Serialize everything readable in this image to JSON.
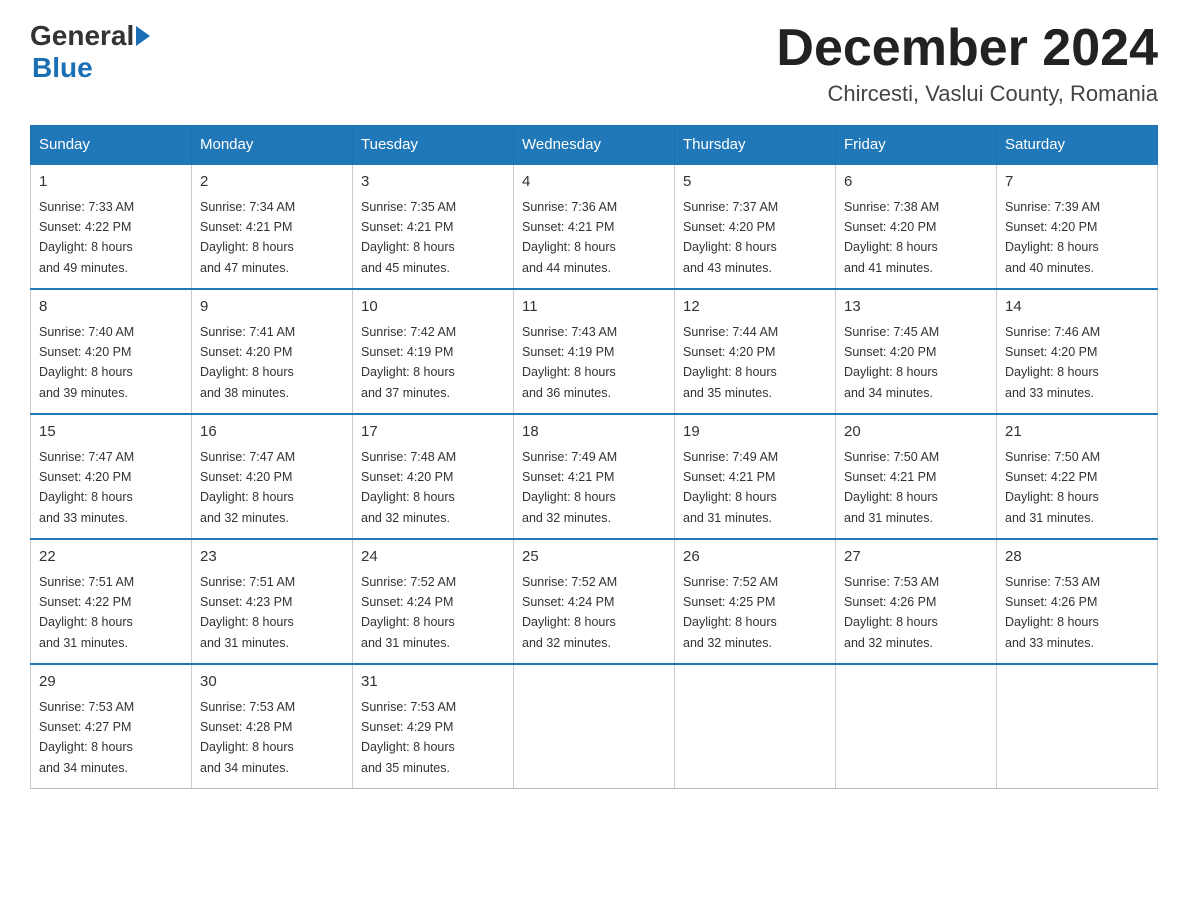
{
  "logo": {
    "general": "General",
    "blue": "Blue"
  },
  "header": {
    "month_year": "December 2024",
    "location": "Chircesti, Vaslui County, Romania"
  },
  "days_of_week": [
    "Sunday",
    "Monday",
    "Tuesday",
    "Wednesday",
    "Thursday",
    "Friday",
    "Saturday"
  ],
  "weeks": [
    [
      {
        "day": "1",
        "sunrise": "7:33 AM",
        "sunset": "4:22 PM",
        "daylight": "8 hours and 49 minutes."
      },
      {
        "day": "2",
        "sunrise": "7:34 AM",
        "sunset": "4:21 PM",
        "daylight": "8 hours and 47 minutes."
      },
      {
        "day": "3",
        "sunrise": "7:35 AM",
        "sunset": "4:21 PM",
        "daylight": "8 hours and 45 minutes."
      },
      {
        "day": "4",
        "sunrise": "7:36 AM",
        "sunset": "4:21 PM",
        "daylight": "8 hours and 44 minutes."
      },
      {
        "day": "5",
        "sunrise": "7:37 AM",
        "sunset": "4:20 PM",
        "daylight": "8 hours and 43 minutes."
      },
      {
        "day": "6",
        "sunrise": "7:38 AM",
        "sunset": "4:20 PM",
        "daylight": "8 hours and 41 minutes."
      },
      {
        "day": "7",
        "sunrise": "7:39 AM",
        "sunset": "4:20 PM",
        "daylight": "8 hours and 40 minutes."
      }
    ],
    [
      {
        "day": "8",
        "sunrise": "7:40 AM",
        "sunset": "4:20 PM",
        "daylight": "8 hours and 39 minutes."
      },
      {
        "day": "9",
        "sunrise": "7:41 AM",
        "sunset": "4:20 PM",
        "daylight": "8 hours and 38 minutes."
      },
      {
        "day": "10",
        "sunrise": "7:42 AM",
        "sunset": "4:19 PM",
        "daylight": "8 hours and 37 minutes."
      },
      {
        "day": "11",
        "sunrise": "7:43 AM",
        "sunset": "4:19 PM",
        "daylight": "8 hours and 36 minutes."
      },
      {
        "day": "12",
        "sunrise": "7:44 AM",
        "sunset": "4:20 PM",
        "daylight": "8 hours and 35 minutes."
      },
      {
        "day": "13",
        "sunrise": "7:45 AM",
        "sunset": "4:20 PM",
        "daylight": "8 hours and 34 minutes."
      },
      {
        "day": "14",
        "sunrise": "7:46 AM",
        "sunset": "4:20 PM",
        "daylight": "8 hours and 33 minutes."
      }
    ],
    [
      {
        "day": "15",
        "sunrise": "7:47 AM",
        "sunset": "4:20 PM",
        "daylight": "8 hours and 33 minutes."
      },
      {
        "day": "16",
        "sunrise": "7:47 AM",
        "sunset": "4:20 PM",
        "daylight": "8 hours and 32 minutes."
      },
      {
        "day": "17",
        "sunrise": "7:48 AM",
        "sunset": "4:20 PM",
        "daylight": "8 hours and 32 minutes."
      },
      {
        "day": "18",
        "sunrise": "7:49 AM",
        "sunset": "4:21 PM",
        "daylight": "8 hours and 32 minutes."
      },
      {
        "day": "19",
        "sunrise": "7:49 AM",
        "sunset": "4:21 PM",
        "daylight": "8 hours and 31 minutes."
      },
      {
        "day": "20",
        "sunrise": "7:50 AM",
        "sunset": "4:21 PM",
        "daylight": "8 hours and 31 minutes."
      },
      {
        "day": "21",
        "sunrise": "7:50 AM",
        "sunset": "4:22 PM",
        "daylight": "8 hours and 31 minutes."
      }
    ],
    [
      {
        "day": "22",
        "sunrise": "7:51 AM",
        "sunset": "4:22 PM",
        "daylight": "8 hours and 31 minutes."
      },
      {
        "day": "23",
        "sunrise": "7:51 AM",
        "sunset": "4:23 PM",
        "daylight": "8 hours and 31 minutes."
      },
      {
        "day": "24",
        "sunrise": "7:52 AM",
        "sunset": "4:24 PM",
        "daylight": "8 hours and 31 minutes."
      },
      {
        "day": "25",
        "sunrise": "7:52 AM",
        "sunset": "4:24 PM",
        "daylight": "8 hours and 32 minutes."
      },
      {
        "day": "26",
        "sunrise": "7:52 AM",
        "sunset": "4:25 PM",
        "daylight": "8 hours and 32 minutes."
      },
      {
        "day": "27",
        "sunrise": "7:53 AM",
        "sunset": "4:26 PM",
        "daylight": "8 hours and 32 minutes."
      },
      {
        "day": "28",
        "sunrise": "7:53 AM",
        "sunset": "4:26 PM",
        "daylight": "8 hours and 33 minutes."
      }
    ],
    [
      {
        "day": "29",
        "sunrise": "7:53 AM",
        "sunset": "4:27 PM",
        "daylight": "8 hours and 34 minutes."
      },
      {
        "day": "30",
        "sunrise": "7:53 AM",
        "sunset": "4:28 PM",
        "daylight": "8 hours and 34 minutes."
      },
      {
        "day": "31",
        "sunrise": "7:53 AM",
        "sunset": "4:29 PM",
        "daylight": "8 hours and 35 minutes."
      },
      null,
      null,
      null,
      null
    ]
  ],
  "labels": {
    "sunrise": "Sunrise:",
    "sunset": "Sunset:",
    "daylight": "Daylight:"
  }
}
